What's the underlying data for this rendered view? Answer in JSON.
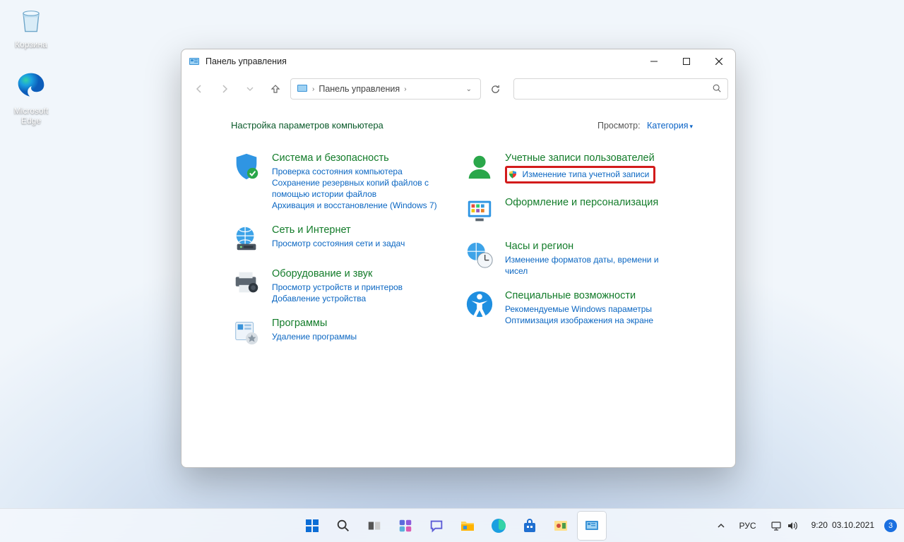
{
  "desktop": {
    "recycle_label": "Корзина",
    "edge_label": "Microsoft Edge"
  },
  "window": {
    "title": "Панель управления",
    "breadcrumb": "Панель управления",
    "search_placeholder": ""
  },
  "content": {
    "heading": "Настройка параметров компьютера",
    "viewby_label": "Просмотр:",
    "viewby_value": "Категория"
  },
  "categories": {
    "system": {
      "title": "Система и безопасность",
      "sub1": "Проверка состояния компьютера",
      "sub2": "Сохранение резервных копий файлов с помощью истории файлов",
      "sub3": "Архивация и восстановление (Windows 7)"
    },
    "network": {
      "title": "Сеть и Интернет",
      "sub1": "Просмотр состояния сети и задач"
    },
    "hardware": {
      "title": "Оборудование и звук",
      "sub1": "Просмотр устройств и принтеров",
      "sub2": "Добавление устройства"
    },
    "programs": {
      "title": "Программы",
      "sub1": "Удаление программы"
    },
    "users": {
      "title": "Учетные записи пользователей",
      "sub1": "Изменение типа учетной записи"
    },
    "personalization": {
      "title": "Оформление и персонализация"
    },
    "clock_region": {
      "title": "Часы и регион",
      "sub1": "Изменение форматов даты, времени и чисел"
    },
    "accessibility": {
      "title": "Специальные возможности",
      "sub1": "Рекомендуемые Windows параметры",
      "sub2": "Оптимизация изображения на экране"
    }
  },
  "tray": {
    "lang": "РУС",
    "time": "9:20",
    "date": "03.10.2021",
    "badge": "3"
  }
}
